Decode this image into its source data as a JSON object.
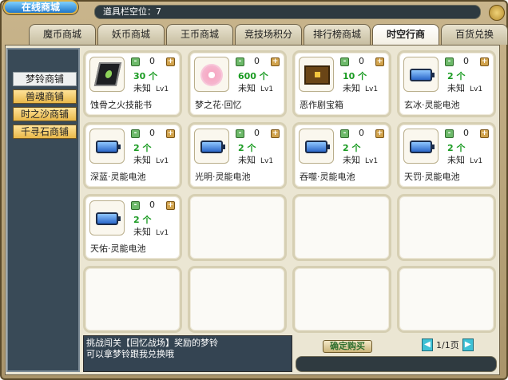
{
  "header": {
    "title": "在线商城",
    "slot_label": "道具栏空位：7"
  },
  "tabs": [
    {
      "label": "魔币商城"
    },
    {
      "label": "妖币商城"
    },
    {
      "label": "王币商城"
    },
    {
      "label": "竞技场积分"
    },
    {
      "label": "排行榜商城"
    },
    {
      "label": "时空行商"
    },
    {
      "label": "百货兑换"
    }
  ],
  "active_tab": "时空行商",
  "sidebar": {
    "items": [
      {
        "label": "梦铃商铺"
      },
      {
        "label": "兽魂商铺"
      },
      {
        "label": "时之沙商铺"
      },
      {
        "label": "千寻石商铺"
      }
    ]
  },
  "products": [
    {
      "name": "蚀骨之火技能书",
      "price": "30 个",
      "qty": "0",
      "level_text": "未知",
      "level": "Lv1",
      "icon": "skill-book-icon"
    },
    {
      "name": "梦之花·回忆",
      "price": "600 个",
      "qty": "0",
      "level_text": "未知",
      "level": "Lv1",
      "icon": "flower-icon"
    },
    {
      "name": "恶作剧宝箱",
      "price": "10 个",
      "qty": "0",
      "level_text": "未知",
      "level": "Lv1",
      "icon": "treasure-chest-icon"
    },
    {
      "name": "玄冰·灵能电池",
      "price": "2 个",
      "qty": "0",
      "level_text": "未知",
      "level": "Lv1",
      "icon": "battery-icon"
    },
    {
      "name": "深蓝·灵能电池",
      "price": "2 个",
      "qty": "0",
      "level_text": "未知",
      "level": "Lv1",
      "icon": "battery-icon"
    },
    {
      "name": "光明·灵能电池",
      "price": "2 个",
      "qty": "0",
      "level_text": "未知",
      "level": "Lv1",
      "icon": "battery-icon"
    },
    {
      "name": "吞噬·灵能电池",
      "price": "2 个",
      "qty": "0",
      "level_text": "未知",
      "level": "Lv1",
      "icon": "battery-icon"
    },
    {
      "name": "天罚·灵能电池",
      "price": "2 个",
      "qty": "0",
      "level_text": "未知",
      "level": "Lv1",
      "icon": "battery-icon"
    },
    {
      "name": "天佑·灵能电池",
      "price": "2 个",
      "qty": "0",
      "level_text": "未知",
      "level": "Lv1",
      "icon": "battery-icon"
    }
  ],
  "message": {
    "line1": "挑战闯关【回忆战场】奖励的梦铃",
    "line2": "可以拿梦铃跟我兑换哦"
  },
  "buy_button": "确定购买",
  "pager": {
    "text": "1/1页"
  }
}
